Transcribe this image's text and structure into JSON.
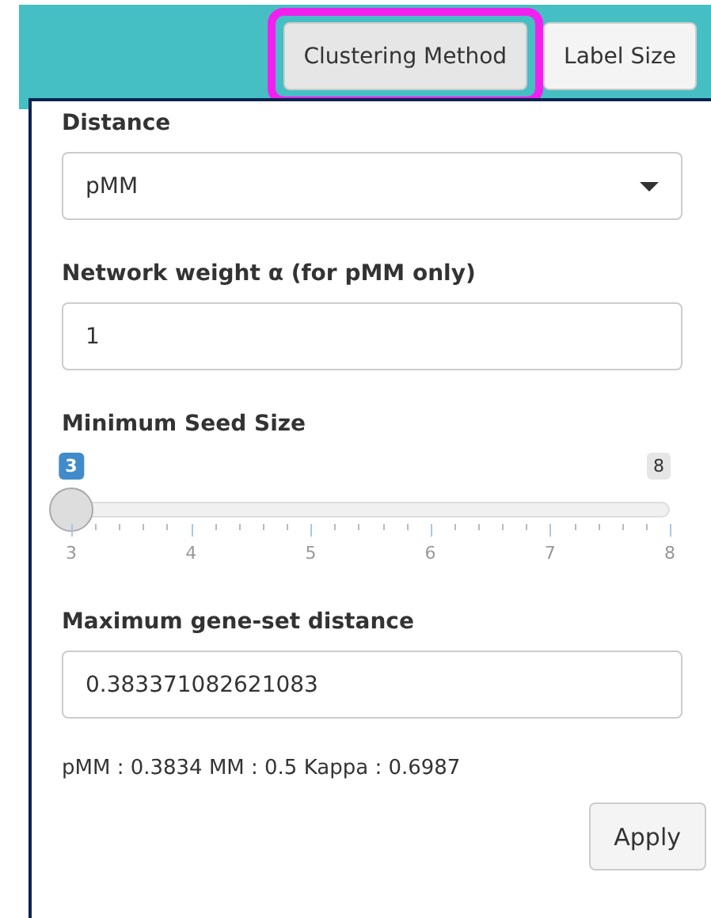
{
  "toolbar": {
    "buttons": [
      {
        "label": "Clustering Method",
        "highlighted": true
      },
      {
        "label": "Label Size",
        "highlighted": false
      }
    ]
  },
  "panel": {
    "fields": [
      {
        "kind": "select",
        "label": "Distance",
        "value": "pMM"
      },
      {
        "kind": "input",
        "label": "Network weight α (for pMM only)",
        "value": "1"
      },
      {
        "kind": "slider",
        "label": "Minimum Seed Size",
        "value": "3",
        "max_label": "8",
        "level": 0,
        "ticks": [
          "3",
          "4",
          "5",
          "6",
          "7",
          "8"
        ]
      },
      {
        "kind": "input",
        "label": "Maximum gene-set distance",
        "value": "0.383371082621083"
      }
    ],
    "summary": "pMM : 0.3834 MM : 0.5 Kappa : 0.6987",
    "apply": "Apply"
  }
}
